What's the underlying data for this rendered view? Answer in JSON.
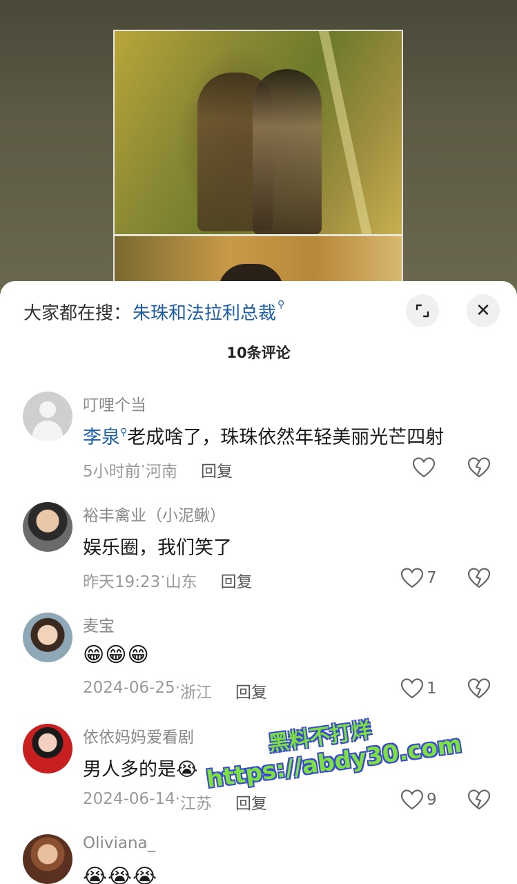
{
  "video": {
    "description_icons": []
  },
  "search_hint": {
    "prefix": "大家都在搜：",
    "term": "朱珠和法拉利总裁",
    "search_glyph": "⚲"
  },
  "header_buttons": {
    "expand_icon": "expand-icon",
    "close_icon": "close-icon",
    "close_glyph": "✕"
  },
  "comment_count": "10条评论",
  "comments": [
    {
      "username": "叮哩个当",
      "mention": "李泉",
      "text": "老成啥了，珠珠依然年轻美丽光芒四射",
      "time": "5小时前",
      "location": "河南",
      "reply": "回复",
      "likes": ""
    },
    {
      "username": "裕丰禽业（小泥鳅）",
      "text": "娱乐圈，我们笑了",
      "time": "昨天19:23",
      "location": "山东",
      "reply": "回复",
      "likes": "7"
    },
    {
      "username": "麦宝",
      "text": "😁😁😁",
      "time": "2024-06-25",
      "location": "浙江",
      "reply": "回复",
      "likes": "1"
    },
    {
      "username": "依依妈妈爱看剧",
      "text": "男人多的是😭",
      "time": "2024-06-14",
      "location": "江苏",
      "reply": "回复",
      "likes": "9"
    },
    {
      "username": "Oliviana_",
      "text": "😭😭😭",
      "time": "",
      "location": "",
      "reply": "",
      "likes": ""
    }
  ],
  "meta_separator": " · ",
  "watermark": {
    "line1": "黑料不打烊",
    "line2": "https://abdy30.com"
  },
  "colors": {
    "link": "#1e5fa6",
    "watermark_fill": "#7de040",
    "watermark_outline": "#3a4ad0"
  }
}
